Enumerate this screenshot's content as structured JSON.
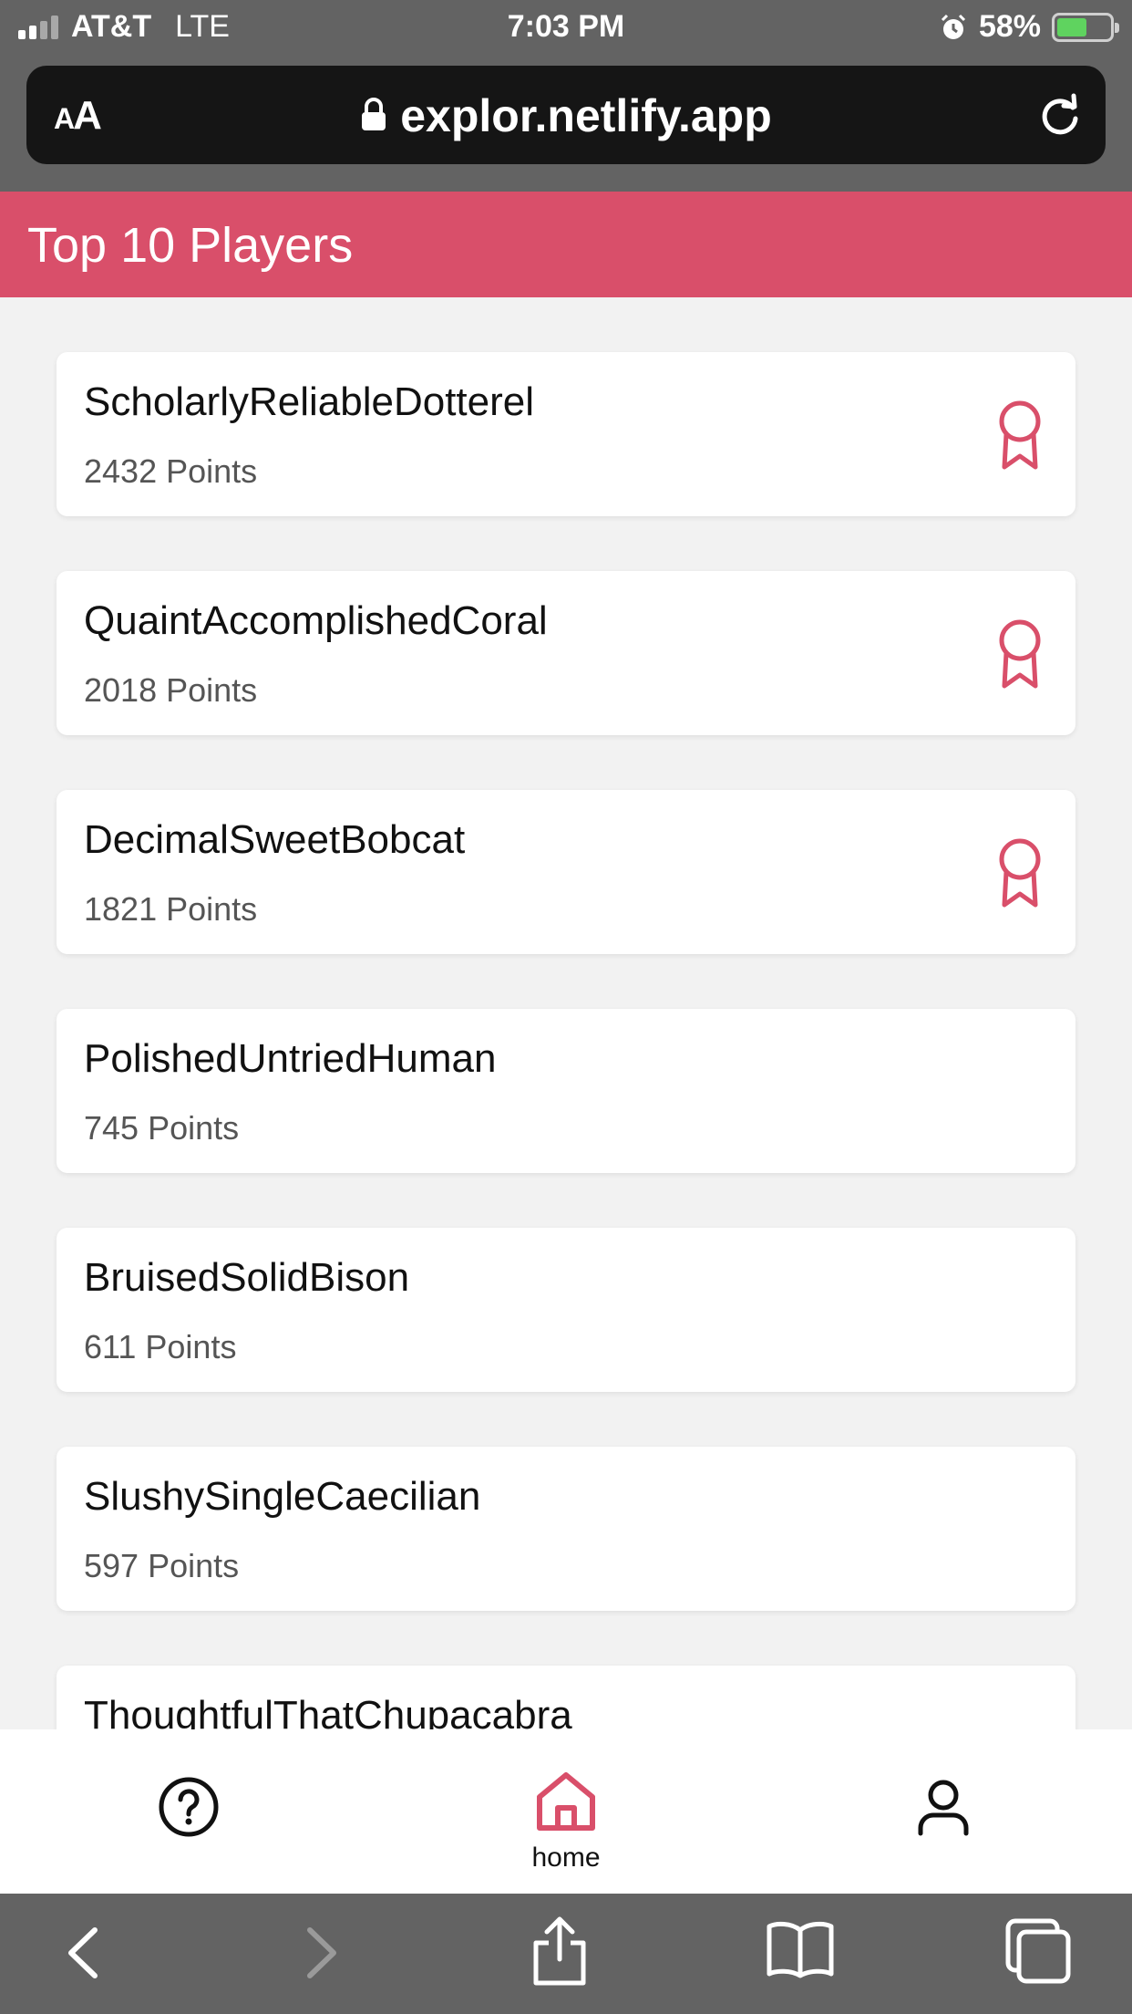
{
  "status_bar": {
    "carrier": "AT&T",
    "network": "LTE",
    "time": "7:03 PM",
    "battery": "58%",
    "battery_level": 0.58
  },
  "browser": {
    "text_size_label_small": "A",
    "text_size_label_large": "A",
    "url": "explor.netlify.app"
  },
  "page": {
    "title": "Top 10 Players"
  },
  "players": [
    {
      "name": "ScholarlyReliableDotterel",
      "points": "2432 Points"
    },
    {
      "name": "QuaintAccomplishedCoral",
      "points": "2018 Points"
    },
    {
      "name": "DecimalSweetBobcat",
      "points": "1821 Points"
    },
    {
      "name": "PolishedUntriedHuman",
      "points": "745 Points"
    },
    {
      "name": "BruisedSolidBison",
      "points": "611 Points"
    },
    {
      "name": "SlushySingleCaecilian",
      "points": "597 Points"
    },
    {
      "name": "ThoughtfulThatChupacabra",
      "points": ""
    }
  ],
  "nav": {
    "home_label": "home",
    "icons": [
      "help-icon",
      "home-icon",
      "profile-icon"
    ]
  },
  "colors": {
    "accent": "#d94f6a",
    "status_bar": "#636363",
    "background": "#f2f2f2"
  }
}
